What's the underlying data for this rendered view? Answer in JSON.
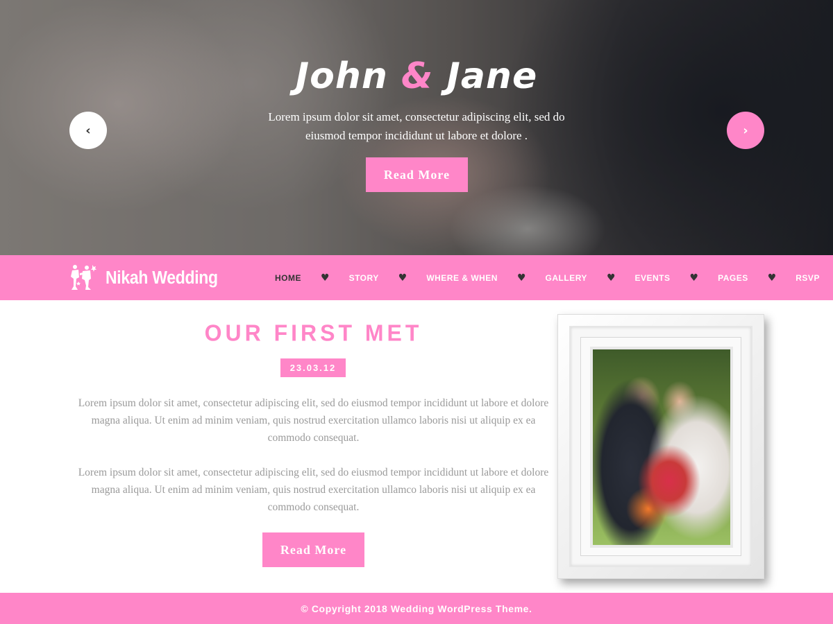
{
  "hero": {
    "title_part1": "John",
    "title_amp": "&",
    "title_part2": "Jane",
    "text": "Lorem ipsum dolor sit amet, consectetur adipiscing elit, sed do eiusmod tempor incididunt ut labore et dolore .",
    "button_label": "Read More",
    "prev_icon": "‹",
    "next_icon": "›"
  },
  "header": {
    "logo_text": "Nikah Wedding",
    "nav": [
      {
        "label": "HOME"
      },
      {
        "label": "STORY"
      },
      {
        "label": "WHERE & WHEN"
      },
      {
        "label": "GALLERY"
      },
      {
        "label": "EVENTS"
      },
      {
        "label": "PAGES"
      },
      {
        "label": "RSVP"
      }
    ],
    "separator_icon": "♥"
  },
  "story": {
    "title": "OUR FIRST MET",
    "date": "23.03.12",
    "paragraph1": "Lorem ipsum dolor sit amet, consectetur adipiscing elit, sed do eiusmod tempor incididunt ut labore et dolore magna aliqua. Ut enim ad minim veniam, quis nostrud exercitation ullamco laboris nisi ut aliquip ex ea commodo consequat.",
    "paragraph2": "Lorem ipsum dolor sit amet, consectetur adipiscing elit, sed do eiusmod tempor incididunt ut labore et dolore magna aliqua. Ut enim ad minim veniam, quis nostrud exercitation ullamco laboris nisi ut aliquip ex ea commodo consequat.",
    "button_label": "Read More"
  },
  "footer": {
    "copyright": "© Copyright 2018 Wedding WordPress Theme."
  },
  "colors": {
    "accent": "#ff86c8",
    "dark": "#333333",
    "muted_text": "#9a9a9a"
  }
}
